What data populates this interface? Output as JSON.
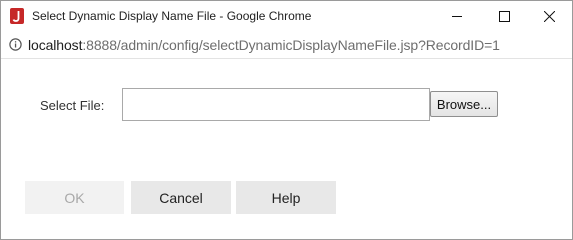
{
  "window": {
    "title": "Select Dynamic Display Name File - Google Chrome"
  },
  "address": {
    "host": "localhost",
    "path": ":8888/admin/config/selectDynamicDisplayNameFile.jsp?RecordID=1"
  },
  "form": {
    "select_file_label": "Select File:",
    "file_value": "",
    "browse_label": "Browse..."
  },
  "actions": {
    "ok_label": "OK",
    "cancel_label": "Cancel",
    "help_label": "Help"
  },
  "colors": {
    "app_icon": "#c62828",
    "disabled_text": "#a8a8a8"
  }
}
